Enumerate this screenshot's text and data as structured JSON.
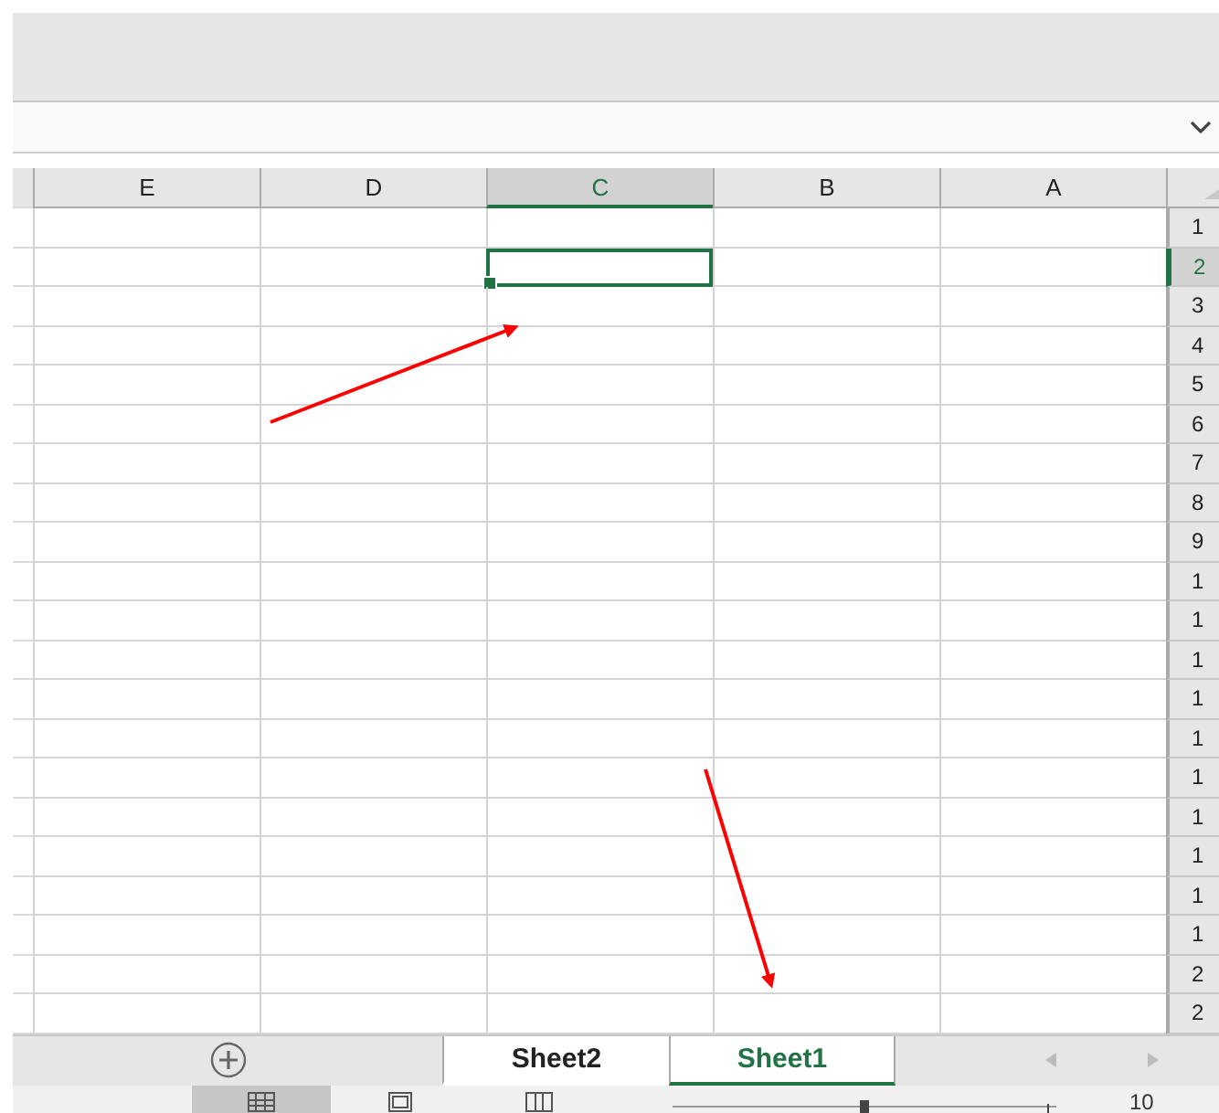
{
  "columns": [
    {
      "label": "E",
      "selected": false
    },
    {
      "label": "D",
      "selected": false
    },
    {
      "label": "C",
      "selected": true
    },
    {
      "label": "B",
      "selected": false
    },
    {
      "label": "A",
      "selected": false
    }
  ],
  "rows": [
    {
      "label": "1",
      "selected": false
    },
    {
      "label": "2",
      "selected": true
    },
    {
      "label": "3",
      "selected": false
    },
    {
      "label": "4",
      "selected": false
    },
    {
      "label": "5",
      "selected": false
    },
    {
      "label": "6",
      "selected": false
    },
    {
      "label": "7",
      "selected": false
    },
    {
      "label": "8",
      "selected": false
    },
    {
      "label": "9",
      "selected": false
    },
    {
      "label": "1",
      "selected": false
    },
    {
      "label": "1",
      "selected": false
    },
    {
      "label": "1",
      "selected": false
    },
    {
      "label": "1",
      "selected": false
    },
    {
      "label": "1",
      "selected": false
    },
    {
      "label": "1",
      "selected": false
    },
    {
      "label": "1",
      "selected": false
    },
    {
      "label": "1",
      "selected": false
    },
    {
      "label": "1",
      "selected": false
    },
    {
      "label": "1",
      "selected": false
    },
    {
      "label": "2",
      "selected": false
    },
    {
      "label": "2",
      "selected": false
    }
  ],
  "sheet_tabs": [
    {
      "label": "Sheet2",
      "selected": false
    },
    {
      "label": "Sheet1",
      "selected": true
    }
  ],
  "status_bar": {
    "views": [
      {
        "selected": true,
        "kind": "normal"
      },
      {
        "selected": false,
        "kind": "layout"
      },
      {
        "selected": false,
        "kind": "pagebreak"
      }
    ],
    "zoom_slider": {
      "level": 0.5
    },
    "zoom": "10"
  }
}
